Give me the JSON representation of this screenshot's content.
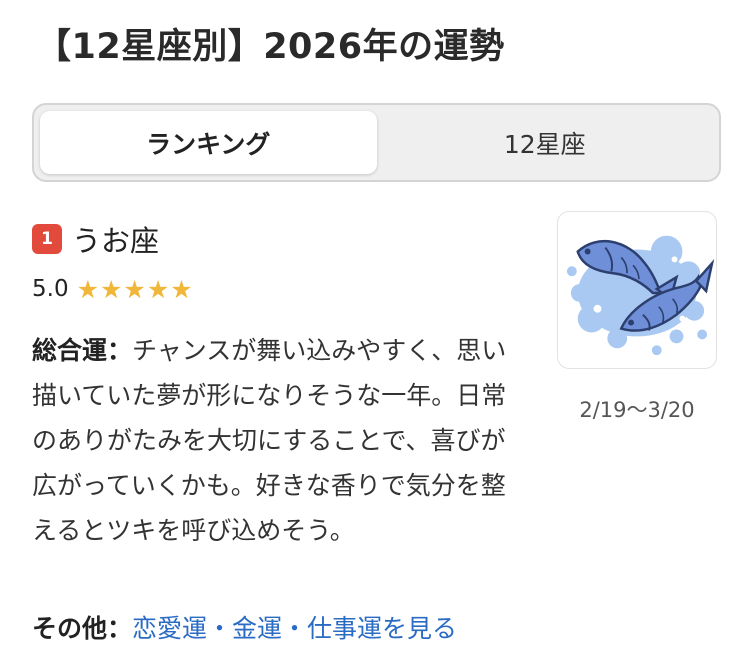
{
  "header": {
    "title": "【12星座別】2026年の運勢"
  },
  "tabs": [
    {
      "label": "ランキング",
      "active": true
    },
    {
      "label": "12星座",
      "active": false
    }
  ],
  "entry": {
    "rank": "1",
    "sign_name": "うお座",
    "score": "5.0",
    "stars": 5,
    "star_color": "#f0b73b",
    "overall_label": "総合運：",
    "overall_text": "チャンスが舞い込みやすく、思い描いていた夢が形になりそうな一年。日常のありがたみを大切にすることで、喜びが広がっていくかも。好きな香りで気分を整えるとツキを呼び込めそう。",
    "other_label": "その他：",
    "other_link": "恋愛運・金運・仕事運を見る",
    "date_range": "2/19〜3/20",
    "image_icon": "pisces-fish-icon"
  },
  "colors": {
    "badge": "#e24b3b",
    "link": "#2a6bc4",
    "fish": "#6f90d9",
    "splash": "#a9c9f2"
  }
}
